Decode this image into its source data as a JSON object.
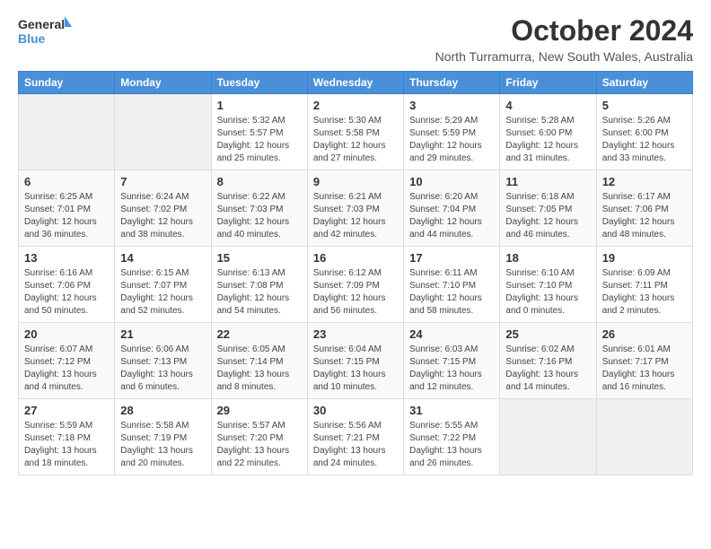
{
  "logo": {
    "line1": "General",
    "line2": "Blue"
  },
  "title": "October 2024",
  "subtitle": "North Turramurra, New South Wales, Australia",
  "headers": [
    "Sunday",
    "Monday",
    "Tuesday",
    "Wednesday",
    "Thursday",
    "Friday",
    "Saturday"
  ],
  "weeks": [
    [
      {
        "day": "",
        "info": ""
      },
      {
        "day": "",
        "info": ""
      },
      {
        "day": "1",
        "info": "Sunrise: 5:32 AM\nSunset: 5:57 PM\nDaylight: 12 hours\nand 25 minutes."
      },
      {
        "day": "2",
        "info": "Sunrise: 5:30 AM\nSunset: 5:58 PM\nDaylight: 12 hours\nand 27 minutes."
      },
      {
        "day": "3",
        "info": "Sunrise: 5:29 AM\nSunset: 5:59 PM\nDaylight: 12 hours\nand 29 minutes."
      },
      {
        "day": "4",
        "info": "Sunrise: 5:28 AM\nSunset: 6:00 PM\nDaylight: 12 hours\nand 31 minutes."
      },
      {
        "day": "5",
        "info": "Sunrise: 5:26 AM\nSunset: 6:00 PM\nDaylight: 12 hours\nand 33 minutes."
      }
    ],
    [
      {
        "day": "6",
        "info": "Sunrise: 6:25 AM\nSunset: 7:01 PM\nDaylight: 12 hours\nand 36 minutes."
      },
      {
        "day": "7",
        "info": "Sunrise: 6:24 AM\nSunset: 7:02 PM\nDaylight: 12 hours\nand 38 minutes."
      },
      {
        "day": "8",
        "info": "Sunrise: 6:22 AM\nSunset: 7:03 PM\nDaylight: 12 hours\nand 40 minutes."
      },
      {
        "day": "9",
        "info": "Sunrise: 6:21 AM\nSunset: 7:03 PM\nDaylight: 12 hours\nand 42 minutes."
      },
      {
        "day": "10",
        "info": "Sunrise: 6:20 AM\nSunset: 7:04 PM\nDaylight: 12 hours\nand 44 minutes."
      },
      {
        "day": "11",
        "info": "Sunrise: 6:18 AM\nSunset: 7:05 PM\nDaylight: 12 hours\nand 46 minutes."
      },
      {
        "day": "12",
        "info": "Sunrise: 6:17 AM\nSunset: 7:06 PM\nDaylight: 12 hours\nand 48 minutes."
      }
    ],
    [
      {
        "day": "13",
        "info": "Sunrise: 6:16 AM\nSunset: 7:06 PM\nDaylight: 12 hours\nand 50 minutes."
      },
      {
        "day": "14",
        "info": "Sunrise: 6:15 AM\nSunset: 7:07 PM\nDaylight: 12 hours\nand 52 minutes."
      },
      {
        "day": "15",
        "info": "Sunrise: 6:13 AM\nSunset: 7:08 PM\nDaylight: 12 hours\nand 54 minutes."
      },
      {
        "day": "16",
        "info": "Sunrise: 6:12 AM\nSunset: 7:09 PM\nDaylight: 12 hours\nand 56 minutes."
      },
      {
        "day": "17",
        "info": "Sunrise: 6:11 AM\nSunset: 7:10 PM\nDaylight: 12 hours\nand 58 minutes."
      },
      {
        "day": "18",
        "info": "Sunrise: 6:10 AM\nSunset: 7:10 PM\nDaylight: 13 hours\nand 0 minutes."
      },
      {
        "day": "19",
        "info": "Sunrise: 6:09 AM\nSunset: 7:11 PM\nDaylight: 13 hours\nand 2 minutes."
      }
    ],
    [
      {
        "day": "20",
        "info": "Sunrise: 6:07 AM\nSunset: 7:12 PM\nDaylight: 13 hours\nand 4 minutes."
      },
      {
        "day": "21",
        "info": "Sunrise: 6:06 AM\nSunset: 7:13 PM\nDaylight: 13 hours\nand 6 minutes."
      },
      {
        "day": "22",
        "info": "Sunrise: 6:05 AM\nSunset: 7:14 PM\nDaylight: 13 hours\nand 8 minutes."
      },
      {
        "day": "23",
        "info": "Sunrise: 6:04 AM\nSunset: 7:15 PM\nDaylight: 13 hours\nand 10 minutes."
      },
      {
        "day": "24",
        "info": "Sunrise: 6:03 AM\nSunset: 7:15 PM\nDaylight: 13 hours\nand 12 minutes."
      },
      {
        "day": "25",
        "info": "Sunrise: 6:02 AM\nSunset: 7:16 PM\nDaylight: 13 hours\nand 14 minutes."
      },
      {
        "day": "26",
        "info": "Sunrise: 6:01 AM\nSunset: 7:17 PM\nDaylight: 13 hours\nand 16 minutes."
      }
    ],
    [
      {
        "day": "27",
        "info": "Sunrise: 5:59 AM\nSunset: 7:18 PM\nDaylight: 13 hours\nand 18 minutes."
      },
      {
        "day": "28",
        "info": "Sunrise: 5:58 AM\nSunset: 7:19 PM\nDaylight: 13 hours\nand 20 minutes."
      },
      {
        "day": "29",
        "info": "Sunrise: 5:57 AM\nSunset: 7:20 PM\nDaylight: 13 hours\nand 22 minutes."
      },
      {
        "day": "30",
        "info": "Sunrise: 5:56 AM\nSunset: 7:21 PM\nDaylight: 13 hours\nand 24 minutes."
      },
      {
        "day": "31",
        "info": "Sunrise: 5:55 AM\nSunset: 7:22 PM\nDaylight: 13 hours\nand 26 minutes."
      },
      {
        "day": "",
        "info": ""
      },
      {
        "day": "",
        "info": ""
      }
    ]
  ]
}
